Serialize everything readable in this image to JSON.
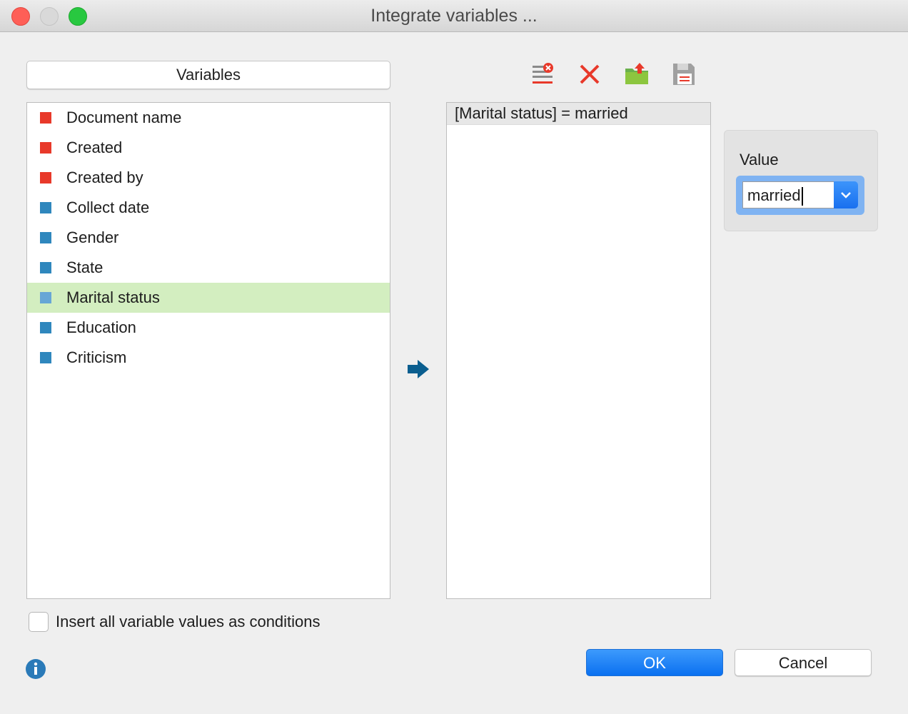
{
  "window": {
    "title": "Integrate variables ..."
  },
  "variables": {
    "header_label": "Variables",
    "items": [
      {
        "label": "Document name",
        "color": "#e8392a"
      },
      {
        "label": "Created",
        "color": "#e8392a"
      },
      {
        "label": "Created by",
        "color": "#e8392a"
      },
      {
        "label": "Collect date",
        "color": "#2f87bd"
      },
      {
        "label": "Gender",
        "color": "#2f87bd"
      },
      {
        "label": "State",
        "color": "#2f87bd"
      },
      {
        "label": "Marital status",
        "color": "#67a6d6",
        "selected": true
      },
      {
        "label": "Education",
        "color": "#2f87bd"
      },
      {
        "label": "Criticism",
        "color": "#2f87bd"
      }
    ]
  },
  "toolbar": {
    "icons": [
      "clear-list-icon",
      "delete-icon",
      "open-folder-icon",
      "save-icon"
    ]
  },
  "conditions": {
    "items": [
      "[Marital status] = married"
    ]
  },
  "value_panel": {
    "label": "Value",
    "current_value": "married"
  },
  "options": {
    "insert_all_label": "Insert all variable values as conditions"
  },
  "buttons": {
    "ok_label": "OK",
    "cancel_label": "Cancel"
  },
  "colors": {
    "selection": "#d3eec0",
    "accent": "#0a70f0"
  }
}
